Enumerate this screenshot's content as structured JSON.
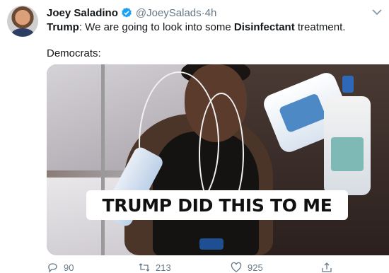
{
  "tweet": {
    "author_name": "Joey Saladino",
    "author_handle": "@JoeySalads",
    "time_sep": " · ",
    "time": "4h",
    "line1_bold": "Trump",
    "line1_text": ": We are going to look into some ",
    "line1_bold2": "Disinfectant",
    "line1_end": " treatment.",
    "line2": "Democrats:",
    "media_caption": "TRUMP DID THIS TO ME"
  },
  "actions": {
    "reply_count": "90",
    "retweet_count": "213",
    "like_count": "925"
  },
  "icons": {
    "verified": "verified-badge-icon",
    "menu": "chevron-down-icon",
    "reply": "reply-icon",
    "retweet": "retweet-icon",
    "like": "heart-icon",
    "share": "share-icon"
  },
  "colors": {
    "verified_blue": "#1da1f2",
    "secondary_text": "#657786"
  }
}
